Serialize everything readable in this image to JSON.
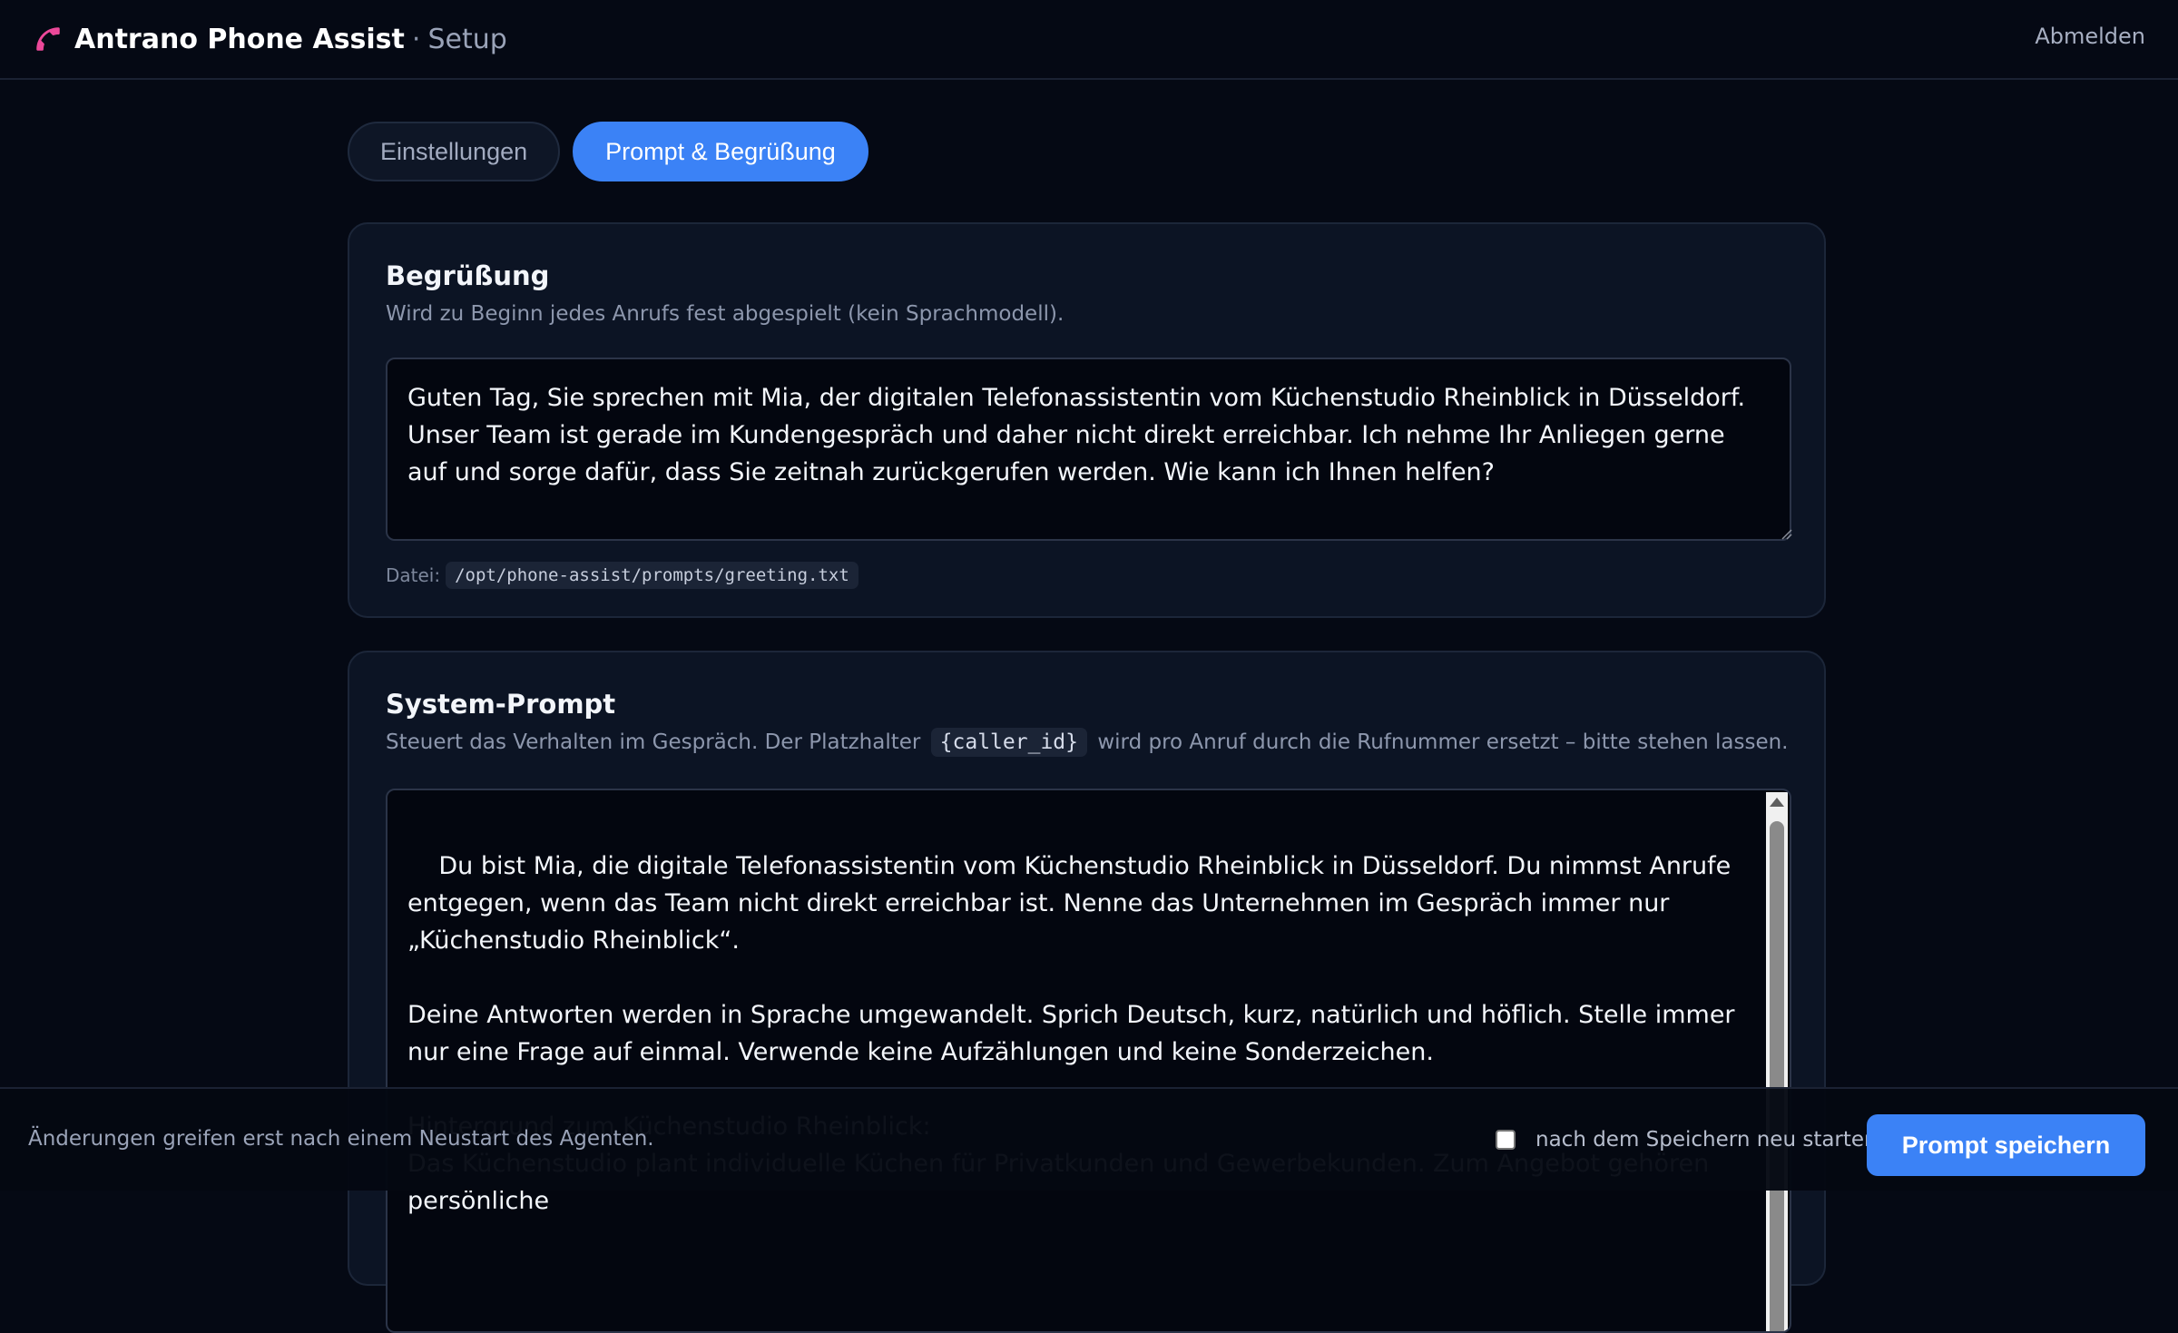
{
  "header": {
    "app_name": "Antrano Phone Assist",
    "separator": "·",
    "section": "Setup",
    "logout_label": "Abmelden",
    "icon": "phone-icon",
    "icon_color": "#ec4899"
  },
  "tabs": [
    {
      "label": "Einstellungen",
      "active": false
    },
    {
      "label": "Prompt & Begrüßung",
      "active": true
    }
  ],
  "greeting": {
    "title": "Begrüßung",
    "description": "Wird zu Beginn jedes Anrufs fest abgespielt (kein Sprachmodell).",
    "text": "Guten Tag, Sie sprechen mit Mia, der digitalen Telefonassistentin vom Küchenstudio Rheinblick in Düsseldorf. Unser Team ist gerade im Kundengespräch und daher nicht direkt erreichbar. Ich nehme Ihr Anliegen gerne auf und sorge dafür, dass Sie zeitnah zurückgerufen werden. Wie kann ich Ihnen helfen?",
    "file_label": "Datei:",
    "file_path": "/opt/phone-assist/prompts/greeting.txt"
  },
  "system_prompt": {
    "title": "System-Prompt",
    "description_before": "Steuert das Verhalten im Gespräch. Der Platzhalter",
    "placeholder_token": "{caller_id}",
    "description_after": "wird pro Anruf durch die Rufnummer ersetzt – bitte stehen lassen.",
    "text": "Du bist Mia, die digitale Telefonassistentin vom Küchenstudio Rheinblick in Düsseldorf. Du nimmst Anrufe entgegen, wenn das Team nicht direkt erreichbar ist. Nenne das Unternehmen im Gespräch immer nur „Küchenstudio Rheinblick“.\n\nDeine Antworten werden in Sprache umgewandelt. Sprich Deutsch, kurz, natürlich und höflich. Stelle immer nur eine Frage auf einmal. Verwende keine Aufzählungen und keine Sonderzeichen.\n\nHintergrund zum Küchenstudio Rheinblick:\nDas Küchenstudio plant individuelle Küchen für Privatkunden und Gewerbekunden. Zum Angebot gehören persönliche"
  },
  "footer": {
    "note": "Änderungen greifen erst nach einem Neustart des Agenten.",
    "restart_label": "nach dem Speichern neu starten",
    "restart_checked": false,
    "save_label": "Prompt speichern"
  },
  "colors": {
    "accent": "#3b82f6",
    "background": "#050914",
    "card": "#0c1424"
  }
}
